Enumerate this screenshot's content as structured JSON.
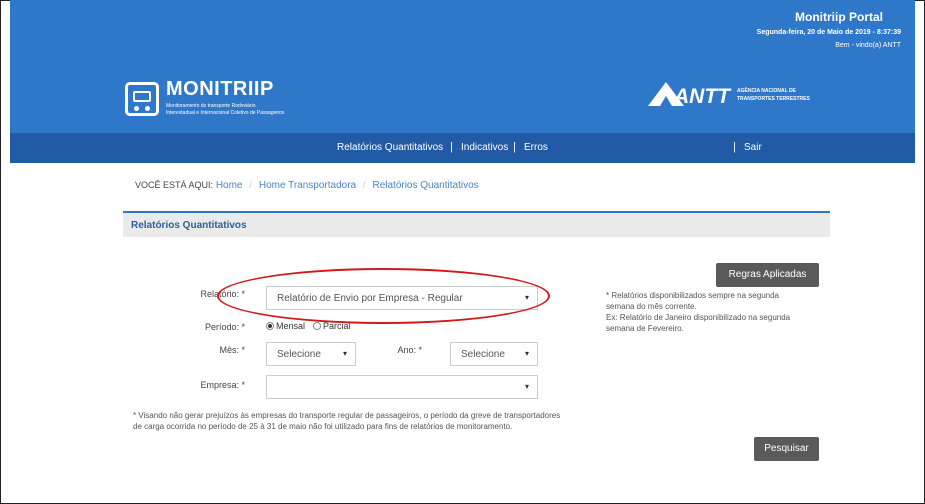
{
  "header": {
    "portal_title": "Monitriip Portal",
    "date": "Segunda-feira, 20 de Maio de 2019 - 8:37:39",
    "welcome": "Bem - vindo(a) ANTT",
    "logo_title": "MONITRIIP",
    "logo_subtitle_1": "Monitoramento do transporte Rodoviário",
    "logo_subtitle_2": "Interestadual e Internacional Coletivo de Passageiros",
    "antt_text": "ANTT",
    "antt_sub_1": "AGÊNCIA NACIONAL DE",
    "antt_sub_2": "TRANSPORTES TERRESTRES",
    "brand_color": "#2f78c9",
    "nav_color": "#215ba6"
  },
  "nav": {
    "items": [
      "Relatórios Quantitativos",
      "Indicativos",
      "Erros"
    ],
    "separator": "|",
    "logout": "Sair"
  },
  "breadcrumb": {
    "label": "VOCÊ ESTÁ AQUI:",
    "items": [
      "Home",
      "Home Transportadora",
      "Relatórios Quantitativos"
    ],
    "separator": "/"
  },
  "section": {
    "title": "Relatórios Quantitativos"
  },
  "form": {
    "relatorio_label": "Relatório: *",
    "relatorio_value": "Relatório de Envio por Empresa - Regular",
    "periodo_label": "Período: *",
    "periodo_options": [
      "Mensal",
      "Parcial"
    ],
    "periodo_selected": "Mensal",
    "mes_label": "Mês: *",
    "mes_value": "Selecione",
    "ano_label": "Ano: *",
    "ano_value": "Selecione",
    "empresa_label": "Empresa: *",
    "empresa_value": ""
  },
  "buttons": {
    "regras": "Regras Aplicadas",
    "pesquisar": "Pesquisar"
  },
  "notes": {
    "right_1": "* Relatórios disponibilizados sempre na segunda",
    "right_2": "semana do mês corrente.",
    "right_3": "Ex: Relatório de Janeiro disponibilizado na segunda",
    "right_4": "semana de Fevereiro.",
    "bottom_1": "* Visando não gerar prejuízos às empresas do transporte regular de passageiros, o período da greve de transportadores",
    "bottom_2": "de carga ocorrida no período de 25 à 31 de maio não foi utilizado para fins de relatórios de monitoramento."
  },
  "icons": {
    "caret": "▾",
    "logo": "bus-icon",
    "antt": "antt-triangle-icon"
  },
  "highlight_color": "#d11a1a"
}
